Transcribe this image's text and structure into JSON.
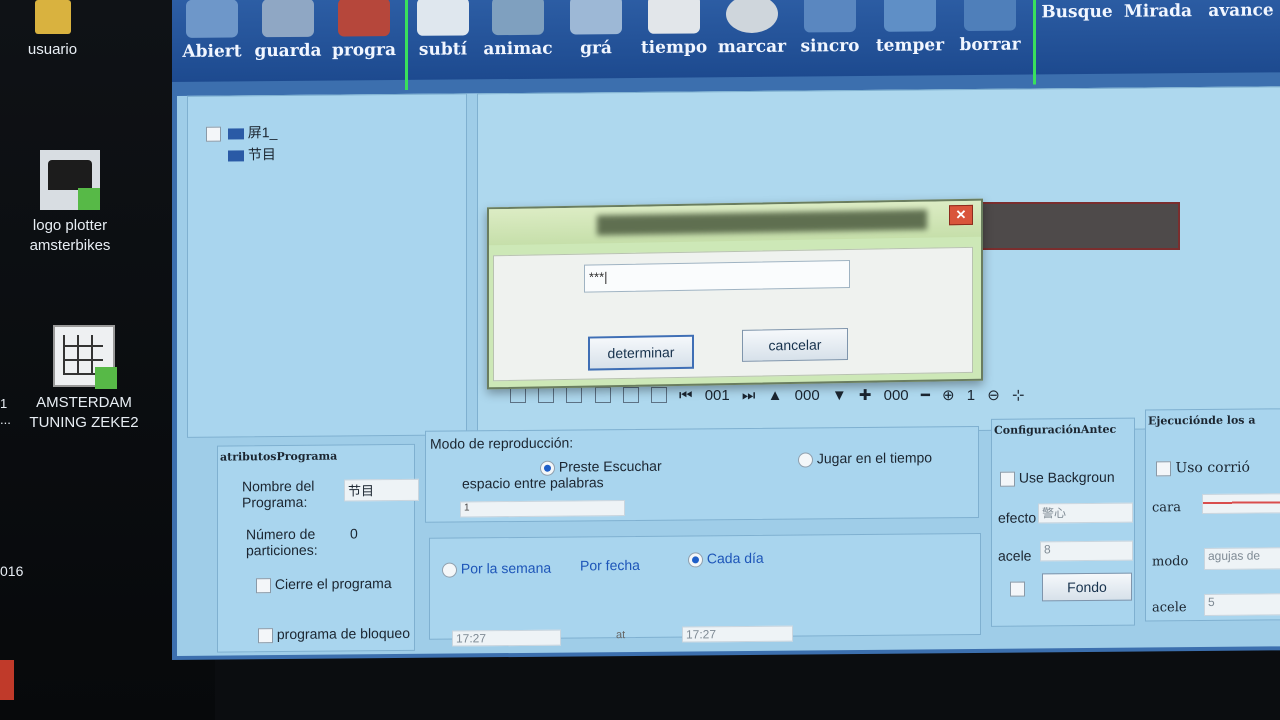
{
  "desktop": {
    "icons": [
      {
        "label": "usuario"
      },
      {
        "label": "logo plotter amsterbikes"
      },
      {
        "label": "AMSTERDAM TUNING ZEKE2"
      }
    ],
    "edge_text_1": "1",
    "edge_text_2": "...",
    "edge_text_3": "016"
  },
  "toolbar": {
    "items": [
      {
        "label": "Abiert"
      },
      {
        "label": "guarda"
      },
      {
        "label": "progra"
      },
      {
        "label": "subtí"
      },
      {
        "label": "animac"
      },
      {
        "label": "grá"
      },
      {
        "label": "tiempo"
      },
      {
        "label": "marcar"
      },
      {
        "label": "sincro"
      },
      {
        "label": "temper"
      },
      {
        "label": "borrar"
      },
      {
        "label": "Busque"
      },
      {
        "label": "Mirada"
      },
      {
        "label": "avance"
      }
    ]
  },
  "tree": {
    "root": "屏1_",
    "child": "节目"
  },
  "dialog": {
    "input_value": "***|",
    "ok_label": "determinar",
    "cancel_label": "cancelar",
    "close_glyph": "✕"
  },
  "nav": {
    "page": "001",
    "up_value": "000",
    "plus_value": "000",
    "zoom": "1"
  },
  "attributes": {
    "header": "atributosPrograma",
    "name_label": "Nombre del Programa:",
    "name_value": "节目",
    "partitions_label": "Número de particiones:",
    "partitions_value": "0",
    "close_program_label": "Cierre el programa",
    "lock_program_label": "programa de bloqueo"
  },
  "playback": {
    "title": "Modo de reproducción:",
    "radio_listen": "Preste Escuchar",
    "radio_time": "Jugar en el tiempo",
    "word_space_label": "espacio entre palabras",
    "word_space_value": "1"
  },
  "schedule": {
    "by_week": "Por la semana",
    "by_date": "Por fecha",
    "every_day": "Cada día",
    "time_start": "17:27",
    "time_mid": "at",
    "time_end": "17:27"
  },
  "background": {
    "header": "ConfiguraciónAntec",
    "use_bg_label": "Use Backgroun",
    "effect_label": "efecto",
    "effect_value": "警心",
    "accel_label": "acele",
    "accel_value": "8",
    "fondo_button": "Fondo"
  },
  "execution": {
    "header": "Ejecuciónde los a",
    "use_run_label": "Uso corrió",
    "face_label": "cara",
    "mode_label": "modo",
    "mode_value": "agujas de",
    "accel_label": "acele",
    "accel_value": "5"
  },
  "colors": {
    "toolbar": "#1d4a8f",
    "workspace": "#9fcde8",
    "dialog": "#cde8b7",
    "accent_green": "#39e05c"
  }
}
